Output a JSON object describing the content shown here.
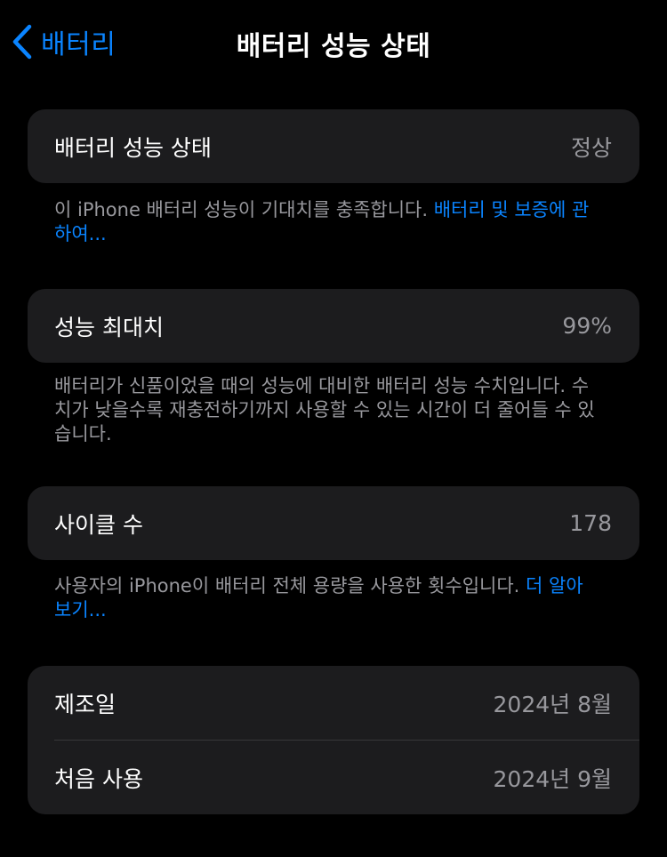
{
  "nav": {
    "back_label": "배터리",
    "title": "배터리 성능 상태"
  },
  "sections": {
    "health": {
      "label": "배터리 성능 상태",
      "value": "정상",
      "footnote": "이 iPhone 배터리 성능이 기대치를 충족합니다. ",
      "footnote_link": "배터리 및 보증에 관하여..."
    },
    "max_capacity": {
      "label": "성능 최대치",
      "value": "99%",
      "footnote": "배터리가 신품이었을 때의 성능에 대비한 배터리 성능 수치입니다. 수치가 낮을수록 재충전하기까지 사용할 수 있는 시간이 더 줄어들 수 있습니다."
    },
    "cycle_count": {
      "label": "사이클 수",
      "value": "178",
      "footnote": "사용자의 iPhone이 배터리 전체 용량을 사용한 횟수입니다. ",
      "footnote_link": "더 알아보기..."
    },
    "dates": {
      "manufacture_label": "제조일",
      "manufacture_value": "2024년 8월",
      "first_use_label": "처음 사용",
      "first_use_value": "2024년 9월"
    }
  },
  "colors": {
    "background": "#000000",
    "card": "#1c1c1e",
    "accent": "#0a84ff",
    "secondary_text": "#98989d"
  },
  "icons": {
    "back": "chevron-left-icon"
  }
}
